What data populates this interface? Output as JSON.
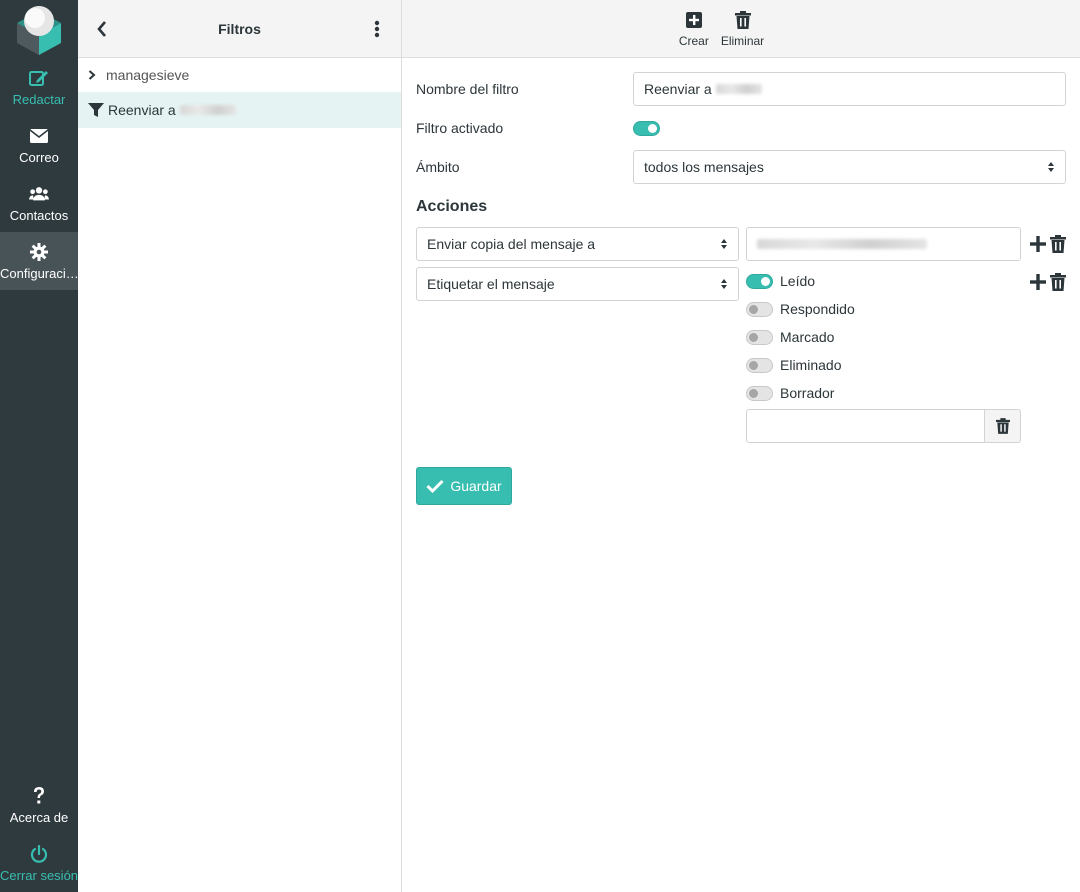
{
  "nav": {
    "items": [
      {
        "label": "Redactar",
        "icon": "compose-icon"
      },
      {
        "label": "Correo",
        "icon": "envelope-icon"
      },
      {
        "label": "Contactos",
        "icon": "users-icon"
      },
      {
        "label": "Configuraci…",
        "icon": "gear-icon"
      }
    ],
    "bottom": [
      {
        "label": "Acerca de",
        "icon": "question-icon"
      },
      {
        "label": "Cerrar sesión",
        "icon": "power-icon"
      }
    ]
  },
  "list": {
    "title": "Filtros",
    "filter_set": "managesieve",
    "filters": [
      {
        "label": "Reenviar a"
      }
    ]
  },
  "toolbar": {
    "create_label": "Crear",
    "delete_label": "Eliminar"
  },
  "form": {
    "name_label": "Nombre del filtro",
    "name_value": "Reenviar a",
    "enabled_label": "Filtro activado",
    "enabled": true,
    "scope_label": "Ámbito",
    "scope_value": "todos los mensajes",
    "actions_title": "Acciones",
    "actions": [
      {
        "type": "Enviar copia del mensaje a"
      },
      {
        "type": "Etiquetar el mensaje"
      }
    ],
    "flags": [
      {
        "label": "Leído",
        "on": true
      },
      {
        "label": "Respondido",
        "on": false
      },
      {
        "label": "Marcado",
        "on": false
      },
      {
        "label": "Eliminado",
        "on": false
      },
      {
        "label": "Borrador",
        "on": false
      }
    ],
    "custom_flag_value": "",
    "save_label": "Guardar"
  },
  "colors": {
    "accent": "#37beb0",
    "nav_bg": "#2f3a3f",
    "nav_active": "#485357",
    "selected_row": "#e5f4f3"
  }
}
